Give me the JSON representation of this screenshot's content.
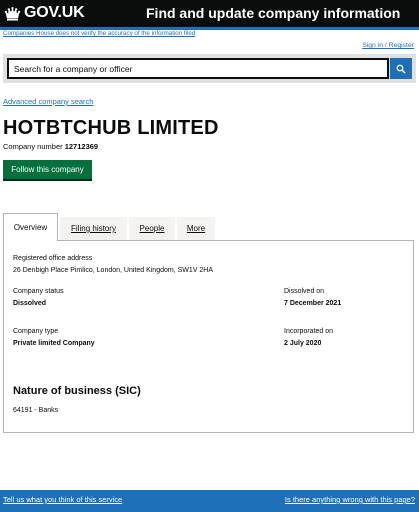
{
  "header": {
    "logo_text": "GOV.UK",
    "service_name": "Find and update company information"
  },
  "disclaimer": "Companies House does not verify the accuracy of the information filed",
  "signin_link": "Sign in / Register",
  "search": {
    "placeholder": "Search for a company or officer",
    "button_icon": "search-icon"
  },
  "advanced_search_link": "Advanced company search",
  "company": {
    "name": "HOTBTCHUB LIMITED",
    "number_label": "Company number",
    "number": "12712369"
  },
  "follow_button": "Follow this company",
  "tabs": [
    {
      "label": "Overview",
      "active": true
    },
    {
      "label": "Filing history",
      "active": false
    },
    {
      "label": "People",
      "active": false
    },
    {
      "label": "More",
      "active": false
    }
  ],
  "overview": {
    "registered_office_label": "Registered office address",
    "registered_office_value": "26 Denbigh Place Pimlico, London, United Kingdom, SW1V 2HA",
    "company_status_label": "Company status",
    "company_status_value": "Dissolved",
    "dissolved_on_label": "Dissolved on",
    "dissolved_on_value": "7 December 2021",
    "company_type_label": "Company type",
    "company_type_value": "Private limited Company",
    "incorporated_on_label": "Incorporated on",
    "incorporated_on_value": "2 July 2020",
    "nature_heading": "Nature of business (SIC)",
    "sic": "64191 - Banks"
  },
  "footer": {
    "feedback_link": "Tell us what you think of this service",
    "wrong_link": "Is there anything wrong with this page?"
  },
  "colors": {
    "header_bg": "#0b0c0c",
    "link_blue": "#1d70b8",
    "button_green": "#00703c"
  }
}
